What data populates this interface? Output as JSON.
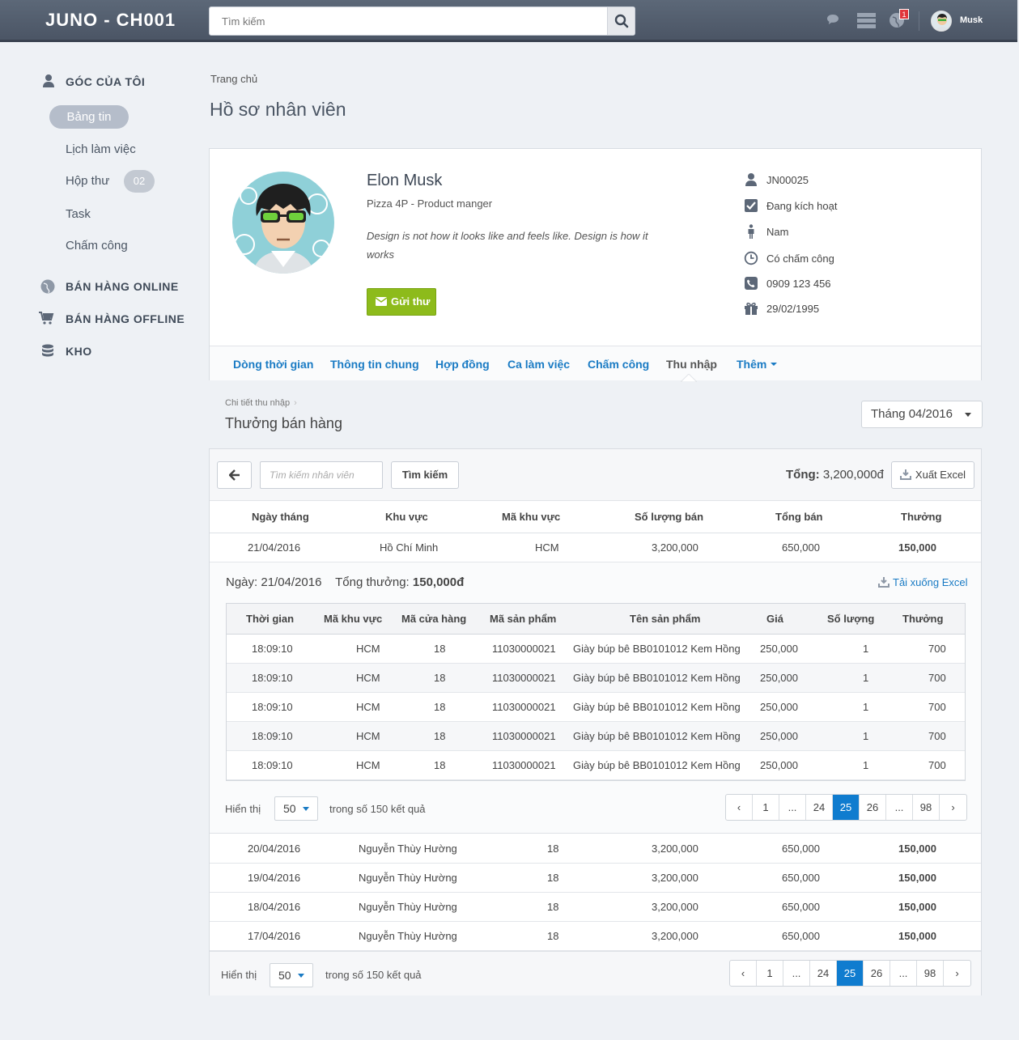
{
  "app": {
    "title": "JUNO - CH001",
    "search_placeholder": "Tìm kiếm",
    "user_name": "Musk",
    "notif_count": "1"
  },
  "sidebar": {
    "section_mine": "GÓC CỦA TÔI",
    "items": [
      {
        "label": "Bảng tin"
      },
      {
        "label": "Lịch làm việc"
      },
      {
        "label": "Hộp thư",
        "count": "02"
      },
      {
        "label": "Task"
      },
      {
        "label": "Chấm công"
      }
    ],
    "online": "BÁN HÀNG ONLINE",
    "offline": "BÁN HÀNG OFFLINE",
    "kho": "KHO"
  },
  "breadcrumb": "Trang chủ",
  "page_title": "Hồ sơ nhân viên",
  "profile": {
    "name": "Elon Musk",
    "role": "Pizza 4P - Product manger",
    "quote": "Design is not how it looks like and feels like.  Design is how it works",
    "send_label": "Gửi thư",
    "info": {
      "code": "JN00025",
      "status": "Đang kích hoạt",
      "gender": "Nam",
      "timekeeping": "Có chấm công",
      "phone": "0909 123 456",
      "birthday": "29/02/1995"
    }
  },
  "tabs": [
    "Dòng thời gian",
    "Thông tin chung",
    "Hợp đồng",
    "Ca làm việc",
    "Chấm công",
    "Thu nhập",
    "Thêm"
  ],
  "section": {
    "crumb": "Chi tiết thu nhập",
    "title": "Thưởng bán hàng",
    "month": "Tháng 04/2016"
  },
  "toolbar": {
    "search_placeholder": "Tìm kiếm nhân viên",
    "search_btn": "Tìm kiếm",
    "total_label": "Tổng:",
    "total_value": "3,200,000đ",
    "export": "Xuất Excel"
  },
  "main_table": {
    "headers": [
      "Ngày tháng",
      "Khu vực",
      "Mã khu vực",
      "Số lượng bán",
      "Tổng bán",
      "Thưởng"
    ],
    "first_row": [
      "21/04/2016",
      "Hồ Chí Minh",
      "HCM",
      "3,200,000",
      "650,000",
      "150,000"
    ],
    "rows": [
      [
        "20/04/2016",
        "Nguyễn Thùy Hường",
        "18",
        "3,200,000",
        "650,000",
        "150,000"
      ],
      [
        "19/04/2016",
        "Nguyễn Thùy Hường",
        "18",
        "3,200,000",
        "650,000",
        "150,000"
      ],
      [
        "18/04/2016",
        "Nguyễn Thùy Hường",
        "18",
        "3,200,000",
        "650,000",
        "150,000"
      ],
      [
        "17/04/2016",
        "Nguyễn Thùy Hường",
        "18",
        "3,200,000",
        "650,000",
        "150,000"
      ]
    ]
  },
  "detail": {
    "date_label": "Ngày: 21/04/2016",
    "bonus_label": "Tổng thưởng:",
    "bonus_value": "150,000đ",
    "download": "Tải xuống Excel",
    "headers": [
      "Thời gian",
      "Mã khu vực",
      "Mã cửa hàng",
      "Mã sản phẩm",
      "Tên sản phẩm",
      "Giá",
      "Số lượng",
      "Thưởng"
    ],
    "rows": [
      [
        "18:09:10",
        "HCM",
        "18",
        "11030000021",
        "Giày búp bê BB0101012 Kem Hồng",
        "250,000",
        "1",
        "700"
      ],
      [
        "18:09:10",
        "HCM",
        "18",
        "11030000021",
        "Giày búp bê BB0101012 Kem Hồng",
        "250,000",
        "1",
        "700"
      ],
      [
        "18:09:10",
        "HCM",
        "18",
        "11030000021",
        "Giày búp bê BB0101012 Kem Hồng",
        "250,000",
        "1",
        "700"
      ],
      [
        "18:09:10",
        "HCM",
        "18",
        "11030000021",
        "Giày búp bê BB0101012 Kem Hồng",
        "250,000",
        "1",
        "700"
      ],
      [
        "18:09:10",
        "HCM",
        "18",
        "11030000021",
        "Giày búp bê BB0101012 Kem Hồng",
        "250,000",
        "1",
        "700"
      ]
    ]
  },
  "pagination": {
    "show_label": "Hiển thị",
    "page_size": "50",
    "summary": "trong số 150 kết quả",
    "pages": [
      "‹",
      "1",
      "...",
      "24",
      "25",
      "26",
      "...",
      "98",
      "›"
    ],
    "current": "25"
  },
  "colors": {
    "topbar": "#515b6a",
    "accent": "#1a7bc4",
    "send_button": "#8dbb1b",
    "page_active": "#0f7ccf"
  }
}
